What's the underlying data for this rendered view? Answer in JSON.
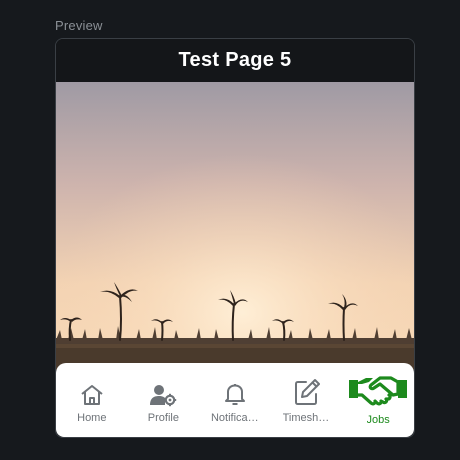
{
  "preview": {
    "label": "Preview"
  },
  "app": {
    "page_title": "Test Page 5"
  },
  "hero": {
    "icon": "sunset-palm-photo"
  },
  "nav": {
    "active_color": "#1d8a1d",
    "inactive_color": "#6e7378",
    "items": [
      {
        "label": "Home",
        "icon": "home-icon",
        "active": false
      },
      {
        "label": "Profile",
        "icon": "user-gear-icon",
        "active": false
      },
      {
        "label": "Notifications",
        "icon": "bell-icon",
        "active": false
      },
      {
        "label": "Timesheets",
        "icon": "edit-icon",
        "active": false
      },
      {
        "label": "Jobs",
        "icon": "handshake-icon",
        "active": true
      }
    ]
  }
}
